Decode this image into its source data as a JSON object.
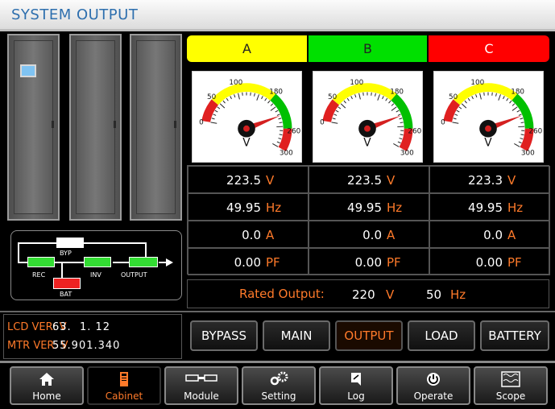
{
  "window": {
    "title": "SYSTEM OUTPUT"
  },
  "colors": {
    "accent": "#ff7a2a",
    "phase_a": "#ffff00",
    "phase_b": "#00e000",
    "phase_c": "#ff0000",
    "title_text": "#2e6fae"
  },
  "mimic": {
    "bypass": "BYP",
    "rectifier": "REC",
    "inverter": "INV",
    "output": "OUTPUT",
    "battery": "BAT"
  },
  "phases": [
    {
      "name": "A",
      "gauge": {
        "ticks": [
          "0",
          "50",
          "100",
          "180",
          "260",
          "300"
        ],
        "unit": "V",
        "reading": 223.5
      },
      "voltage": "223.5",
      "voltage_unit": "V",
      "frequency": "49.95",
      "frequency_unit": "Hz",
      "current": "0.0",
      "current_unit": "A",
      "pf": "0.00",
      "pf_unit": "PF"
    },
    {
      "name": "B",
      "gauge": {
        "ticks": [
          "0",
          "50",
          "100",
          "180",
          "260",
          "300"
        ],
        "unit": "V",
        "reading": 223.5
      },
      "voltage": "223.5",
      "voltage_unit": "V",
      "frequency": "49.95",
      "frequency_unit": "Hz",
      "current": "0.0",
      "current_unit": "A",
      "pf": "0.00",
      "pf_unit": "PF"
    },
    {
      "name": "C",
      "gauge": {
        "ticks": [
          "0",
          "50",
          "100",
          "180",
          "260",
          "300"
        ],
        "unit": "V",
        "reading": 223.3
      },
      "voltage": "223.3",
      "voltage_unit": "V",
      "frequency": "49.95",
      "frequency_unit": "Hz",
      "current": "0.0",
      "current_unit": "A",
      "pf": "0.00",
      "pf_unit": "PF"
    }
  ],
  "rated": {
    "label": "Rated Output:",
    "voltage": "220",
    "voltage_unit": "V",
    "frequency": "50",
    "frequency_unit": "Hz"
  },
  "versions": {
    "lcd_label": "LCD VER: V",
    "lcd_value": "63.  1. 12",
    "mtr_label": "MTR VER: V",
    "mtr_value": "55.901.340"
  },
  "tabs": [
    "BYPASS",
    "MAIN",
    "OUTPUT",
    "LOAD",
    "BATTERY"
  ],
  "active_tab": "OUTPUT",
  "nav": [
    {
      "label": "Home",
      "icon": "home-icon"
    },
    {
      "label": "Cabinet",
      "icon": "cabinet-icon"
    },
    {
      "label": "Module",
      "icon": "module-icon"
    },
    {
      "label": "Setting",
      "icon": "gear-icon"
    },
    {
      "label": "Log",
      "icon": "log-icon"
    },
    {
      "label": "Operate",
      "icon": "power-icon"
    },
    {
      "label": "Scope",
      "icon": "scope-icon"
    }
  ],
  "active_nav": "Cabinet"
}
